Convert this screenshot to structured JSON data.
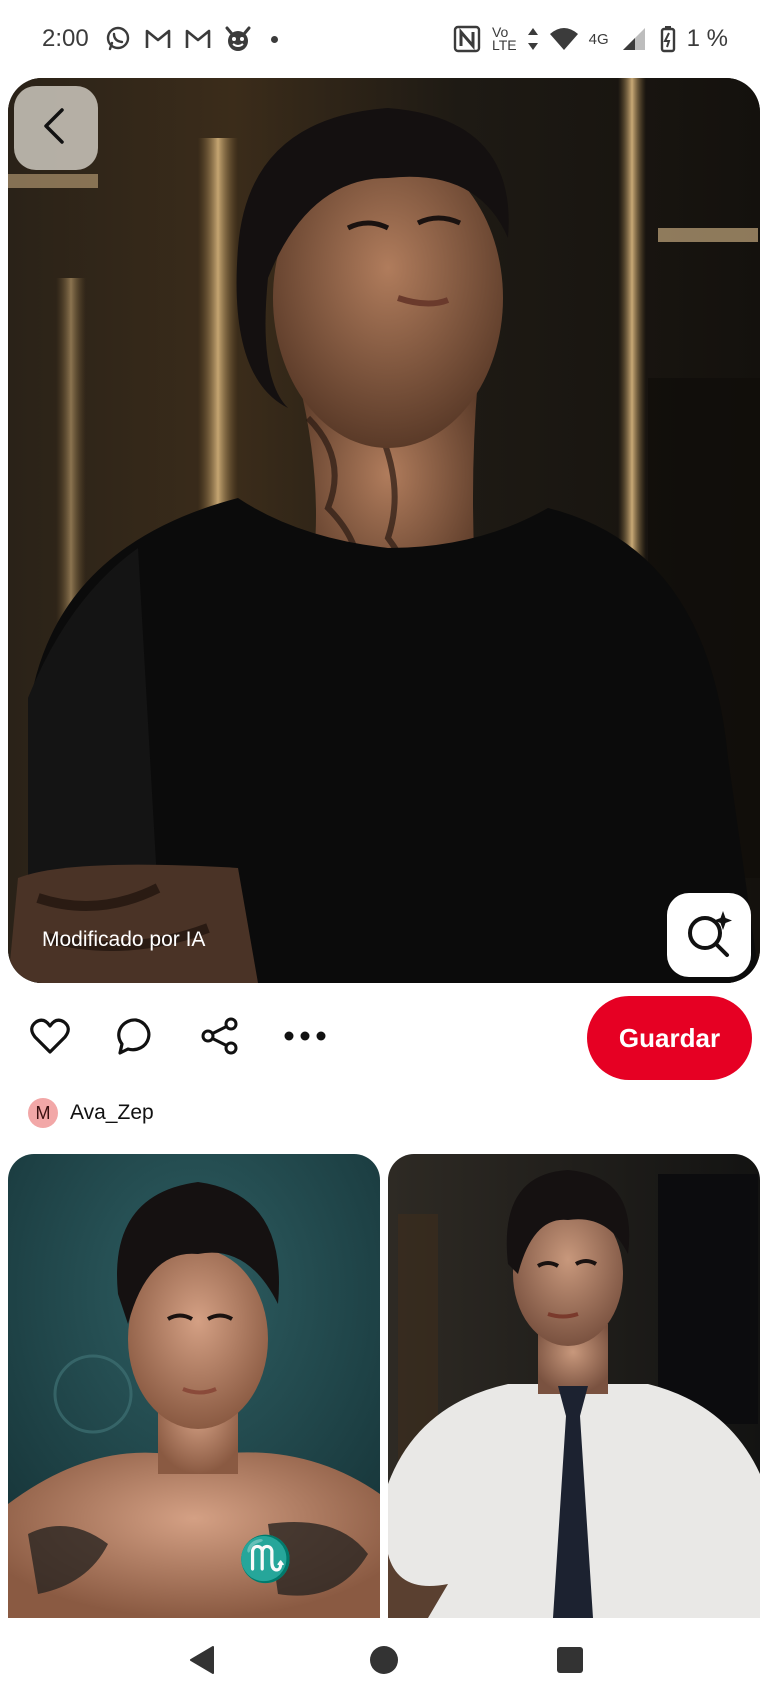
{
  "status_bar": {
    "time": "2:00",
    "battery_text": "1 %",
    "network_label_top": "Vo",
    "network_label_bottom": "LTE",
    "network_type": "4G",
    "notification_icons": [
      "whatsapp-icon",
      "gmail-icon",
      "gmail-icon",
      "devil-face-icon"
    ],
    "system_icons": [
      "nfc-icon",
      "volte-icon",
      "data-arrows-icon",
      "wifi-icon",
      "signal-icon",
      "battery-saver-icon"
    ]
  },
  "pin": {
    "ai_label": "Modificado por IA",
    "back_icon": "chevron-left-icon",
    "visual_search_icon": "sparkle-search-icon"
  },
  "actions": {
    "icons": [
      "heart-icon",
      "comment-icon",
      "share-icon",
      "more-icon"
    ],
    "save_label": "Guardar"
  },
  "author": {
    "initial": "M",
    "name": "Ava_Zep"
  },
  "nav": {
    "icons": [
      "back-triangle-icon",
      "home-circle-icon",
      "recents-square-icon"
    ]
  },
  "colors": {
    "brand_red": "#e60023",
    "avatar_bg": "#f2a7a7"
  }
}
